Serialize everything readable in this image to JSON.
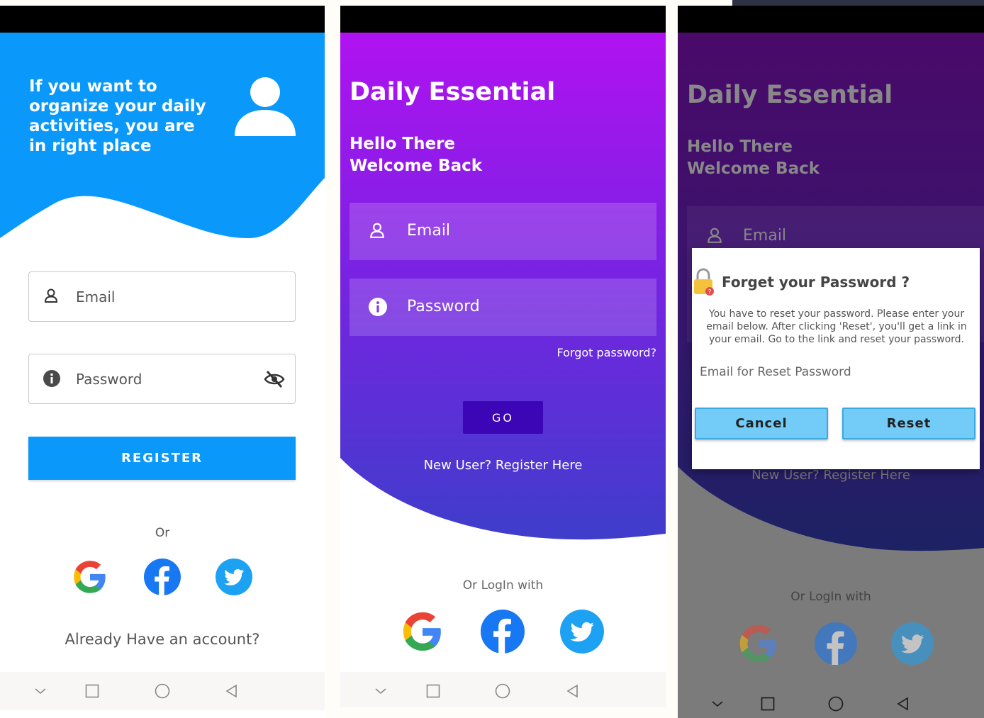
{
  "colors": {
    "screen1_accent": "#0a99fb",
    "screen2_gradient_top": "#b012f0",
    "screen2_gradient_bottom": "#3b3fc9",
    "go_button": "#3c05b5",
    "dialog_button": "#73ccf7"
  },
  "register_screen": {
    "headline": "If you want to organize your daily activities, you are in right place",
    "email_label": "Email",
    "password_label": "Password",
    "register_button": "REGISTER",
    "or_text": "Or",
    "already_account": "Already Have an account?",
    "icons": [
      "user-avatar-icon",
      "person-icon",
      "info-icon",
      "eye-off-icon",
      "google-icon",
      "facebook-icon",
      "twitter-icon"
    ]
  },
  "login_screen": {
    "app_title": "Daily Essential",
    "greeting_line1": "Hello There",
    "greeting_line2": "Welcome Back",
    "email_label": "Email",
    "password_label": "Password",
    "forgot_link": "Forgot password?",
    "go_button": "GO",
    "register_link": "New User? Register Here",
    "or_login": "Or LogIn with"
  },
  "reset_screen": {
    "app_title": "Daily Essential",
    "greeting_line1": "Hello There",
    "greeting_line2": "Welcome Back",
    "email_label": "Email",
    "register_link": "New User? Register Here",
    "or_login": "Or LogIn with",
    "dialog": {
      "title": "Forget your Password ?",
      "message": "You have to reset your password. Please enter your email below. After clicking 'Reset', you'll get a link in your email. Go to the link and reset your password.",
      "input_placeholder": "Email for Reset Password",
      "cancel_button": "Cancel",
      "reset_button": "Reset"
    }
  },
  "navigation_icons": [
    "chevron-down-icon",
    "square-icon",
    "circle-icon",
    "back-triangle-icon"
  ]
}
